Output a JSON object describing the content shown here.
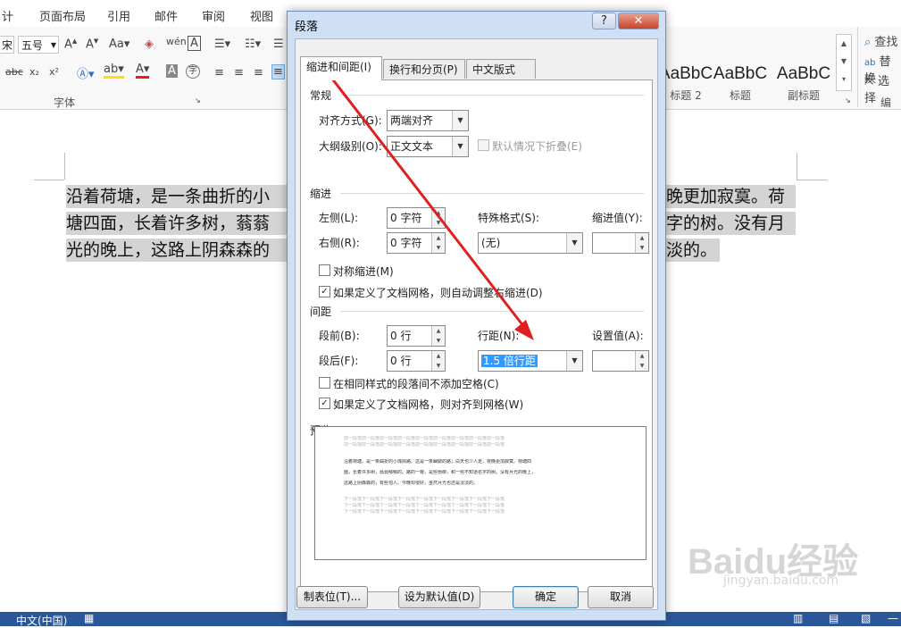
{
  "ribbon": {
    "tabs": [
      "计",
      "页面布局",
      "引用",
      "邮件",
      "审阅",
      "视图"
    ],
    "font_name": "宋",
    "font_size": "五号",
    "font_group_label": "字体",
    "edit_group_label": "编辑",
    "find_label": "查找",
    "replace_label": "替换",
    "select_label": "选择",
    "styles": [
      {
        "sample": "AaBbC",
        "name": "标题 2"
      },
      {
        "sample": "AaBbC",
        "name": "标题"
      },
      {
        "sample": "AaBbC",
        "name": "副标题"
      }
    ]
  },
  "document": {
    "lines": [
      "沿着荷塘，是一条曲折的小",
      "塘四面，长着许多树，蓊蓊",
      "光的晚上，这路上阴森森的"
    ],
    "lines_right": [
      "晚更加寂寞。荷",
      "字的树。没有月",
      "淡的。↵"
    ]
  },
  "statusbar": {
    "language": "中文(中国)"
  },
  "dialog": {
    "title": "段落",
    "help": "?",
    "close": "✕",
    "tabs": [
      "缩进和间距(I)",
      "换行和分页(P)",
      "中文版式(H)"
    ],
    "general": {
      "section": "常规",
      "alignment_label": "对齐方式(G):",
      "alignment_value": "两端对齐",
      "outline_label": "大纲级别(O):",
      "outline_value": "正文文本",
      "collapse_label": "默认情况下折叠(E)"
    },
    "indent": {
      "section": "缩进",
      "left_label": "左侧(L):",
      "left_value": "0 字符",
      "right_label": "右侧(R):",
      "right_value": "0 字符",
      "special_label": "特殊格式(S):",
      "special_value": "(无)",
      "by_label": "缩进值(Y):",
      "by_value": "",
      "mirror_label": "对称缩进(M)",
      "mirror_checked": false,
      "auto_adjust_label": "如果定义了文档网格，则自动调整右缩进(D)",
      "auto_adjust_checked": true
    },
    "spacing": {
      "section": "间距",
      "before_label": "段前(B):",
      "before_value": "0 行",
      "after_label": "段后(F):",
      "after_value": "0 行",
      "line_label": "行距(N):",
      "line_value": "1.5 倍行距",
      "at_label": "设置值(A):",
      "at_value": "",
      "no_space_label": "在相同样式的段落间不添加空格(C)",
      "no_space_checked": false,
      "snap_label": "如果定义了文档网格，则对齐到网格(W)",
      "snap_checked": true
    },
    "preview": {
      "section": "预览",
      "prev_text": "前一段落前一段落前一段落前一段落前一段落前一段落前一段落前一段落前一段落",
      "sample_lines": [
        "沿着荷塘，是一条曲折的小煤屑路。这是一条幽僻的路；白天也少人走，夜晚更加寂寞。荷塘四",
        "面，长着许多树，蓊蓊郁郁的。路的一旁，是些杨柳，和一些不知道名字的树。没有月光的晚上，",
        "这路上阴森森的，有些怕人。今晚却很好，虽然月光也还是淡淡的。"
      ],
      "next_text": "下一段落下一段落下一段落下一段落下一段落下一段落下一段落下一段落下一段落"
    },
    "buttons": {
      "tabs": "制表位(T)...",
      "set_default": "设为默认值(D)",
      "ok": "确定",
      "cancel": "取消"
    }
  },
  "watermark": {
    "brand": "Baidu经验",
    "url": "jingyan.baidu.com"
  },
  "colors": {
    "annotation_arrow": "#e02020",
    "selection": "#3399ff",
    "statusbar": "#2b579a"
  }
}
